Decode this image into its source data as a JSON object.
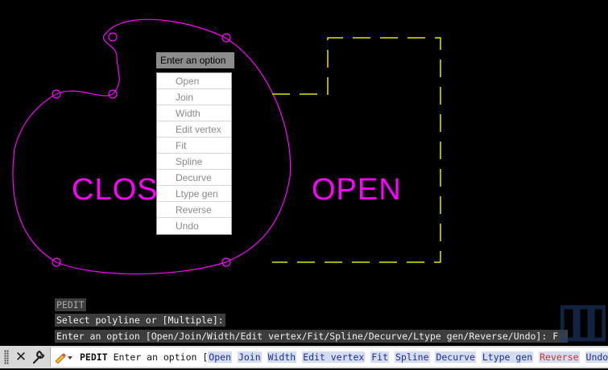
{
  "drawing": {
    "closed_label": "CLOS",
    "open_label": "OPEN",
    "closed_color": "#ff00ff",
    "open_color": "#ffff00"
  },
  "dynamic_input": {
    "prompt": "Enter an option",
    "options": [
      "Open",
      "Join",
      "Width",
      "Edit vertex",
      "Fit",
      "Spline",
      "Decurve",
      "Ltype gen",
      "Reverse",
      "Undo"
    ]
  },
  "history": {
    "line1": "PEDIT",
    "line2": "Select polyline or [Multiple]:",
    "line3": "Enter an option [Open/Join/Width/Edit vertex/Fit/Spline/Decurve/Ltype gen/Reverse/Undo]: F"
  },
  "command_line": {
    "close_icon": "close-icon",
    "customize_icon": "wrench-icon",
    "recent_icon": "recent-commands-icon",
    "command_name": "PEDIT",
    "prompt": "Enter an option",
    "open_bracket": "[",
    "close_bracket": "]:",
    "options": [
      "Open",
      "Join",
      "Width",
      "Edit vertex",
      "Fit",
      "Spline",
      "Decurve",
      "Ltype gen",
      "Reverse",
      "Undo"
    ],
    "highlight_color": "#d6dcf0",
    "option_text_color": "#1b2f8f",
    "hot_key_color": "#e02a2a"
  }
}
